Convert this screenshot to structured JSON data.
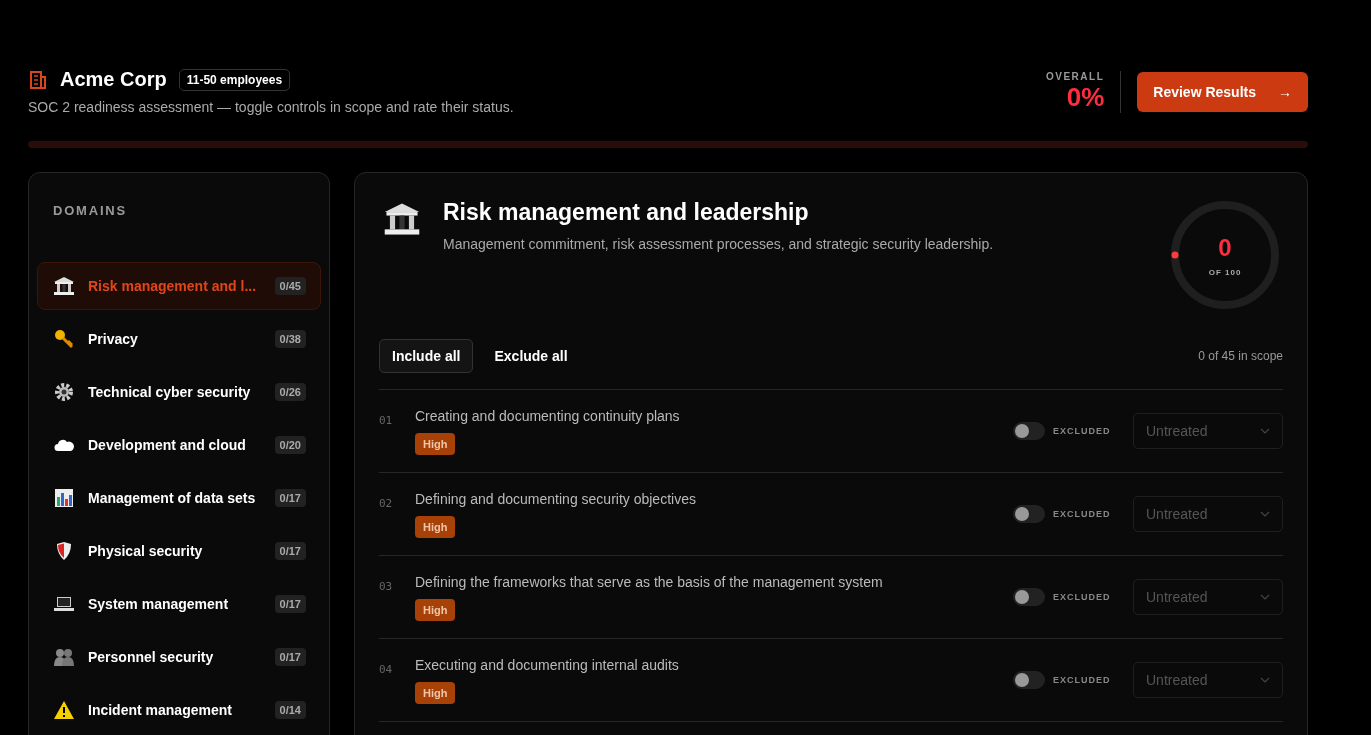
{
  "company": {
    "name": "Acme Corp",
    "size": "11-50 employees",
    "subtitle": "SOC 2 readiness assessment — toggle controls in scope and rate their status."
  },
  "overall": {
    "label": "OVERALL",
    "value": "0%",
    "level": 0
  },
  "review_button": {
    "label": "Review Results",
    "arrow": "→"
  },
  "sidebar": {
    "title": "DOMAINS",
    "items": [
      {
        "label": "Risk management and l...",
        "count": "0/45",
        "selected": true
      },
      {
        "label": "Privacy",
        "count": "0/38",
        "selected": false
      },
      {
        "label": "Technical cyber security",
        "count": "0/26",
        "selected": false
      },
      {
        "label": "Development and cloud",
        "count": "0/20",
        "selected": false
      },
      {
        "label": "Management of data sets",
        "count": "0/17",
        "selected": false
      },
      {
        "label": "Physical security",
        "count": "0/17",
        "selected": false
      },
      {
        "label": "System management",
        "count": "0/17",
        "selected": false
      },
      {
        "label": "Personnel security",
        "count": "0/17",
        "selected": false
      },
      {
        "label": "Incident management",
        "count": "0/14",
        "selected": false
      }
    ]
  },
  "domain": {
    "title": "Risk management and leadership",
    "description": "Management commitment, risk assessment processes, and strategic security leadership.",
    "score": {
      "value": "0",
      "caption": "OF 100",
      "level": 0
    },
    "include_all": "Include all",
    "exclude_all": "Exclude all",
    "scope": "0 of 45 in scope",
    "controls": [
      {
        "number": "01",
        "title": "Creating and documenting continuity plans",
        "priority": "High",
        "on": false,
        "state_label": "EXCLUDED",
        "status": "Untreated"
      },
      {
        "number": "02",
        "title": "Defining and documenting security objectives",
        "priority": "High",
        "on": false,
        "state_label": "EXCLUDED",
        "status": "Untreated"
      },
      {
        "number": "03",
        "title": "Defining the frameworks that serve as the basis of the management system",
        "priority": "High",
        "on": false,
        "state_label": "EXCLUDED",
        "status": "Untreated"
      },
      {
        "number": "04",
        "title": "Executing and documenting internal audits",
        "priority": "High",
        "on": false,
        "state_label": "EXCLUDED",
        "status": "Untreated"
      }
    ]
  }
}
